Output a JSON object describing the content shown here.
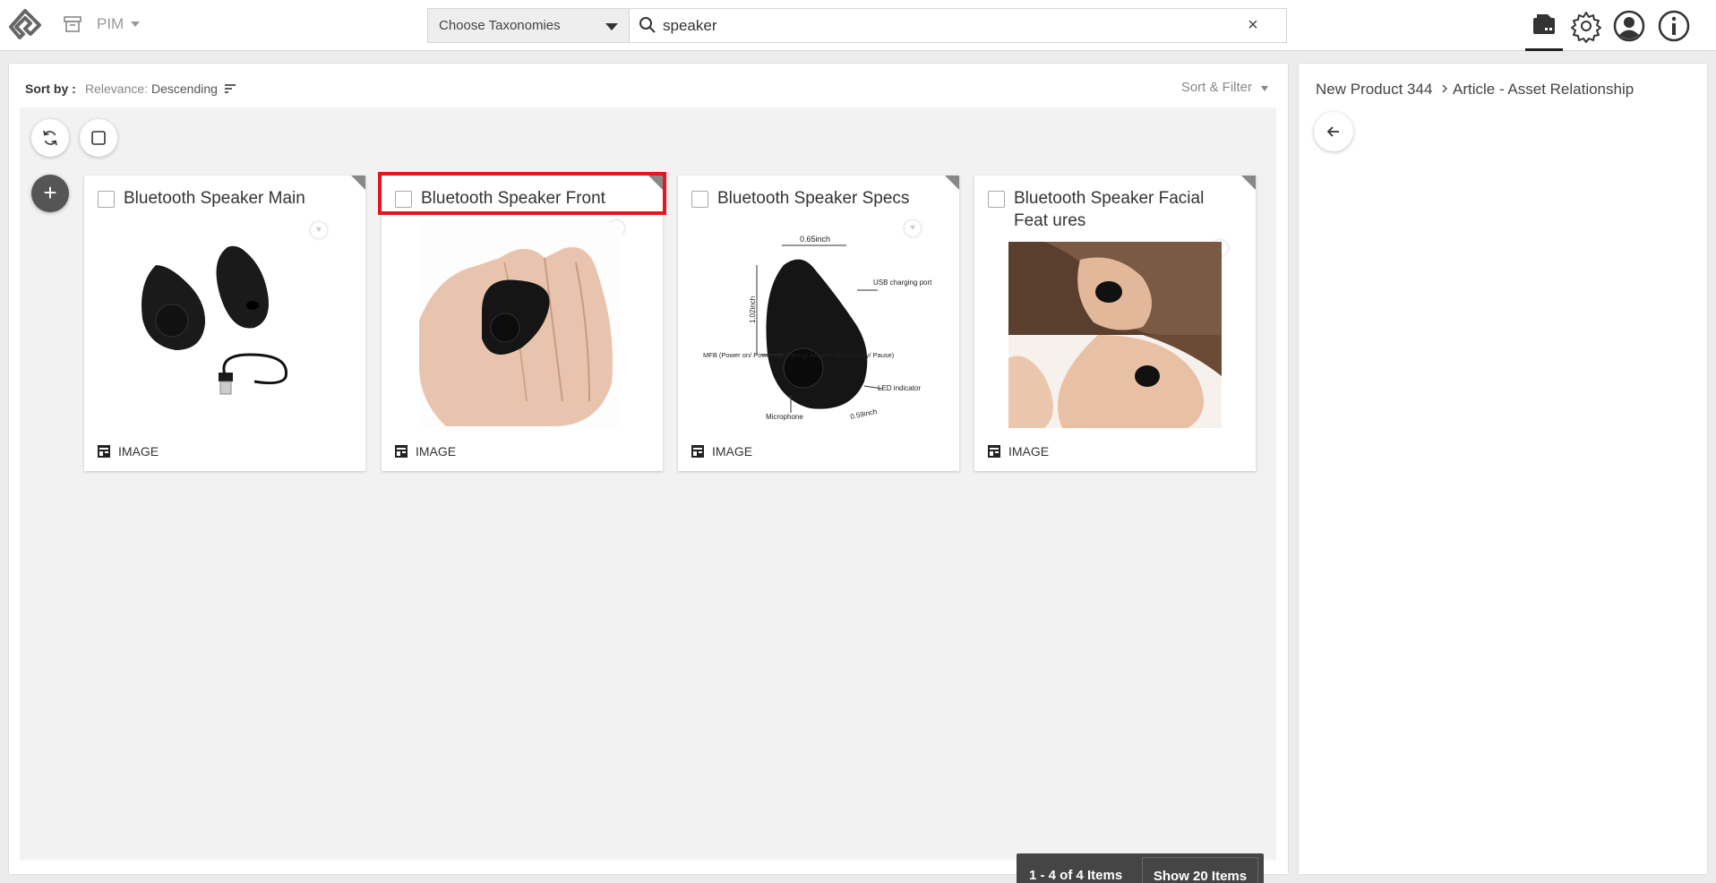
{
  "header": {
    "app_label": "PIM",
    "taxonomy_label": "Choose Taxonomies",
    "search_value": "speaker",
    "clear_symbol": "×",
    "icons": [
      "logo-icon",
      "archive-icon",
      "search-icon",
      "clear-icon",
      "assets-icon",
      "settings-icon",
      "user-icon",
      "info-icon"
    ]
  },
  "toolbar": {
    "sortby_label": "Sort by :",
    "relevance_label": "Relevance:",
    "order_label": "Descending",
    "sortfilter_label": "Sort & Filter"
  },
  "actions": {
    "add_symbol": "+"
  },
  "cards": [
    {
      "title": "Bluetooth Speaker Main",
      "type": "IMAGE",
      "selected": false
    },
    {
      "title": "Bluetooth Speaker Front",
      "type": "IMAGE",
      "selected": false,
      "highlighted": true
    },
    {
      "title": "Bluetooth Speaker Specs",
      "type": "IMAGE",
      "selected": false
    },
    {
      "title": "Bluetooth Speaker Facial Feat ures",
      "type": "IMAGE",
      "selected": false
    }
  ],
  "spec_labels": {
    "width": "0.65inch",
    "usb": "USB charging port",
    "height": "1.02inch",
    "mfb": "MFB (Power on/ Power off/ Pairing/ Answer/ Redial/play/ Pause)",
    "led": "LED indicator",
    "mic": "Microphone",
    "depth": "0.59inch"
  },
  "pagination": {
    "count_label": "1 - 4 of 4 Items",
    "show_label": "Show 20 Items"
  },
  "right_panel": {
    "breadcrumb_1": "New Product 344",
    "breadcrumb_2": "Article - Asset Relationship"
  },
  "colors": {
    "highlight": "#e5161c",
    "pager_bg": "#454545",
    "content_bg": "#f2f2f2"
  }
}
